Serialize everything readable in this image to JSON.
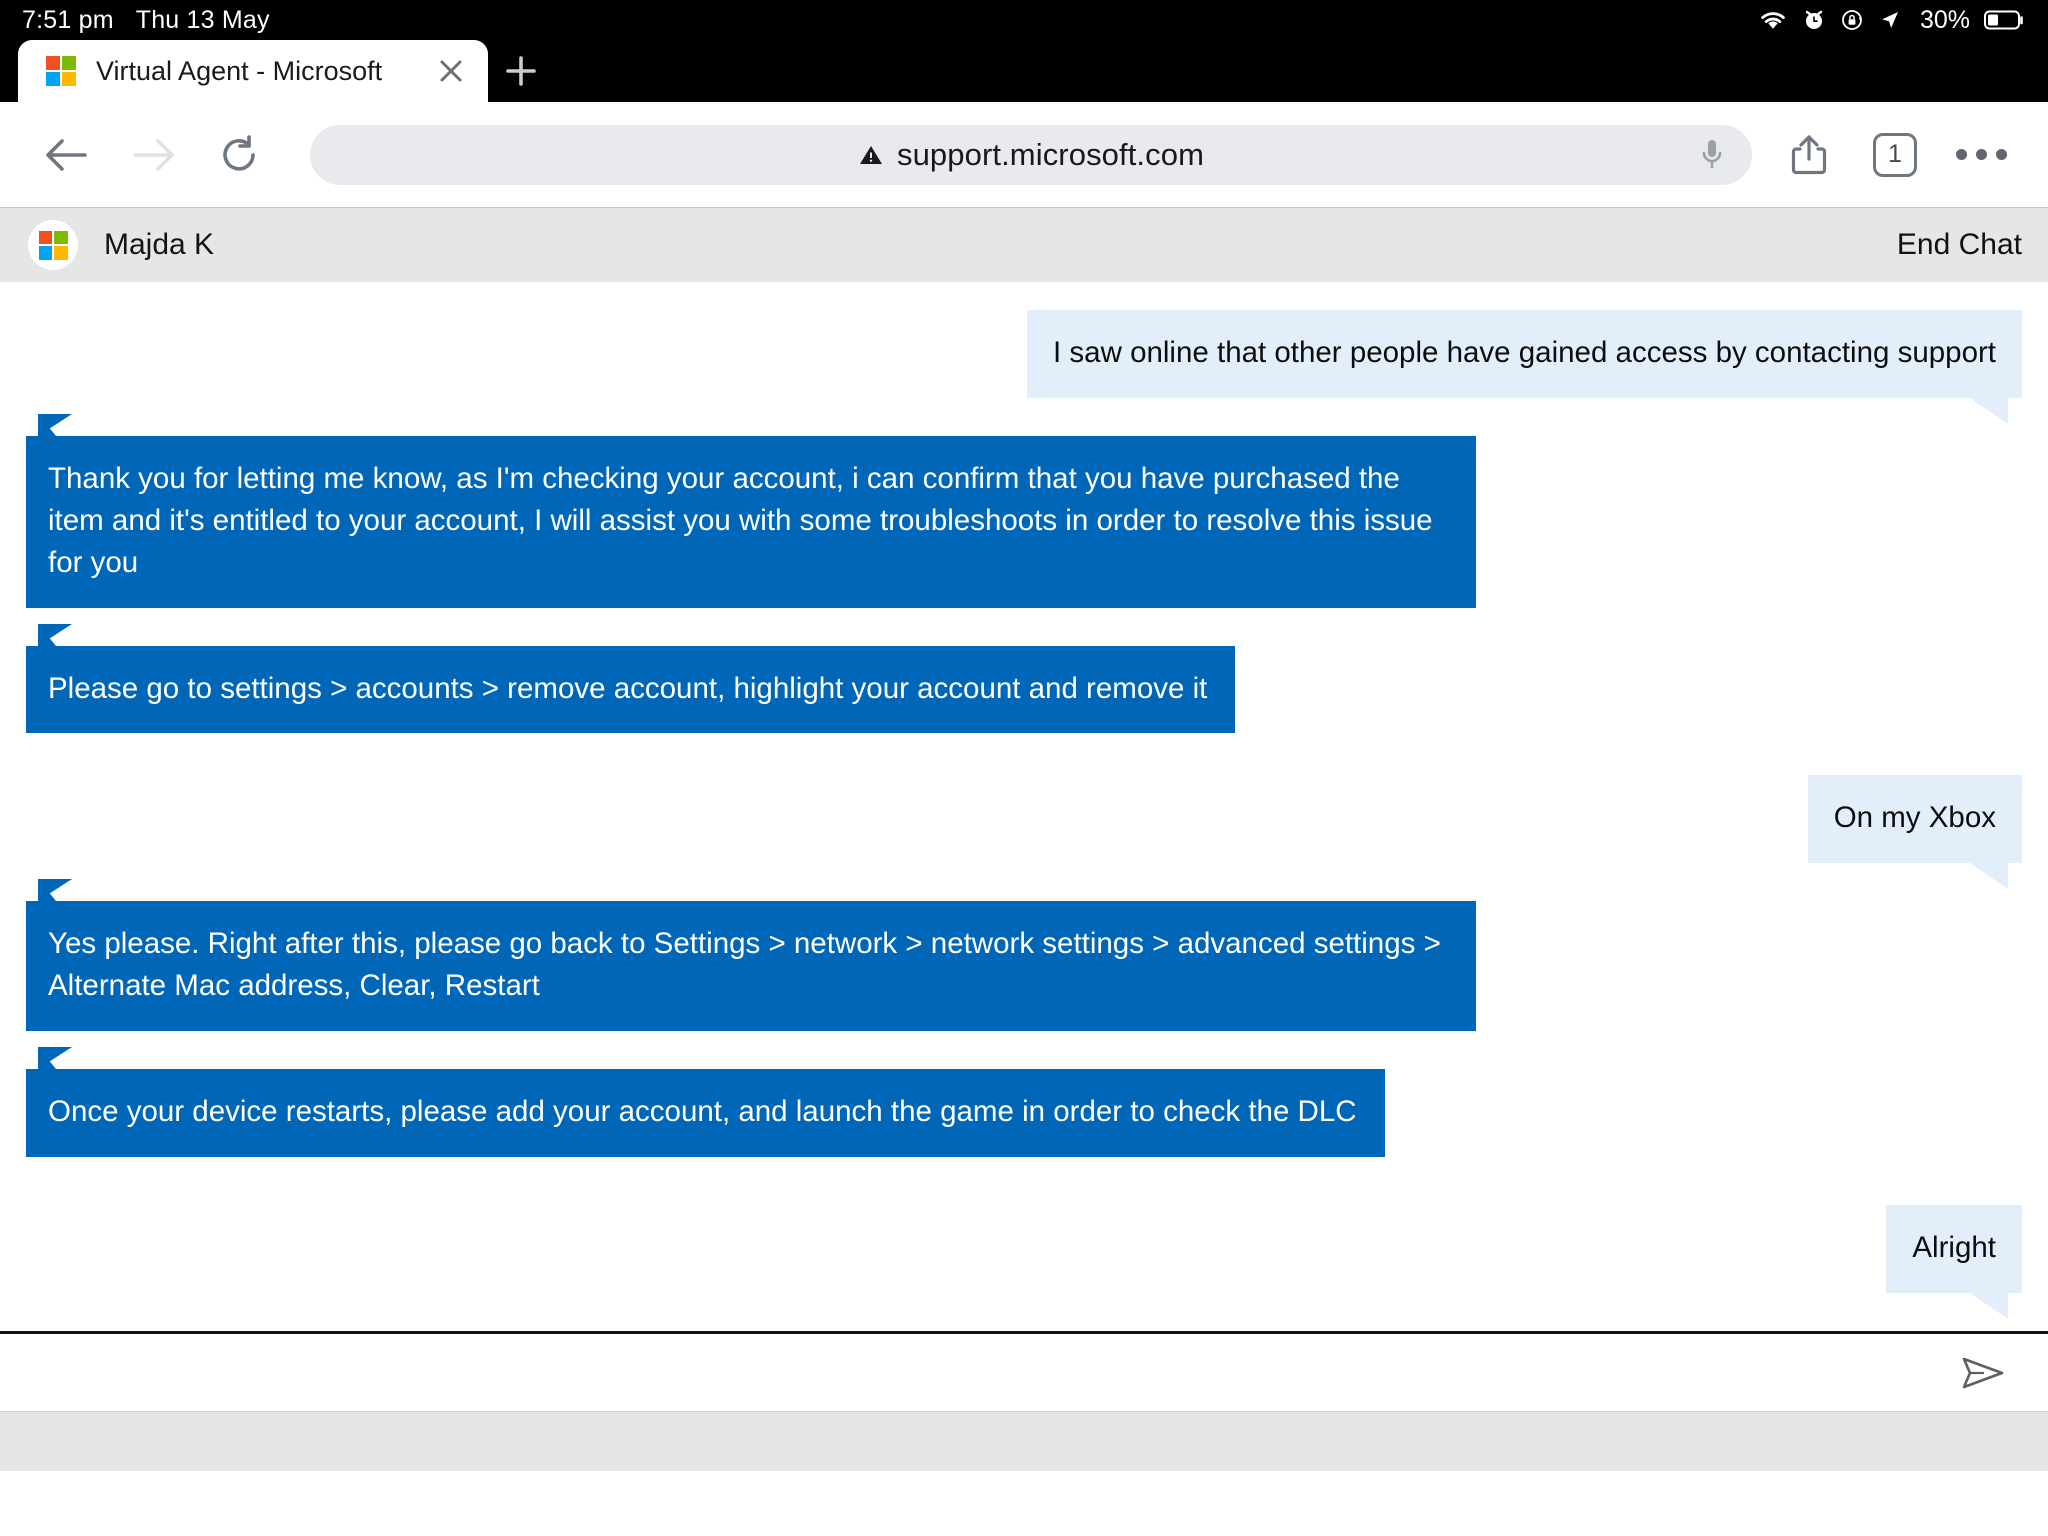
{
  "status_bar": {
    "time": "7:51 pm",
    "date": "Thu 13 May",
    "battery_percent": "30%",
    "icons": [
      "wifi-icon",
      "alarm-clock-icon",
      "rotation-lock-icon",
      "location-arrow-icon",
      "battery-icon"
    ]
  },
  "browser": {
    "tab": {
      "title": "Virtual Agent - Microsoft",
      "favicon": "microsoft-logo-icon",
      "close_label": "✕"
    },
    "new_tab_label": "+",
    "toolbar": {
      "back_icon": "back-arrow-icon",
      "forward_icon": "forward-arrow-icon",
      "reload_icon": "reload-icon",
      "url": "support.microsoft.com",
      "url_warning_icon": "not-secure-warning-icon",
      "mic_icon": "microphone-icon",
      "share_icon": "share-icon",
      "tab_count": "1",
      "more_icon": "more-options-icon"
    }
  },
  "chat": {
    "header": {
      "avatar": "microsoft-logo-icon",
      "agent_name": "Majda K",
      "end_chat_label": "End Chat"
    },
    "messages": [
      {
        "sender": "user",
        "text": "I saw online that other people have gained access by contacting support"
      },
      {
        "sender": "agent",
        "text": "Thank you for letting me know,  as I'm checking your account, i can confirm that you have purchased the item and it's entitled to your account, I will assist you with some troubleshoots in order to resolve this issue for you"
      },
      {
        "sender": "agent",
        "text": "Please go to settings > accounts > remove account, highlight your account and remove it"
      },
      {
        "sender": "user",
        "text": "On my Xbox"
      },
      {
        "sender": "agent",
        "text": "Yes please. Right after this, please go back to Settings > network > network settings > advanced settings > Alternate Mac address, Clear, Restart"
      },
      {
        "sender": "agent",
        "text": "Once your device restarts, please add your account, and launch the game in order to check the DLC"
      },
      {
        "sender": "user",
        "text": "Alright"
      }
    ],
    "composer": {
      "input_value": "",
      "placeholder": "",
      "send_icon": "send-icon"
    }
  },
  "colors": {
    "agent_bubble": "#0067b8",
    "user_bubble": "#e3eefb",
    "header_bg": "#e6e6e6",
    "url_bar_bg": "#e8eaed"
  }
}
